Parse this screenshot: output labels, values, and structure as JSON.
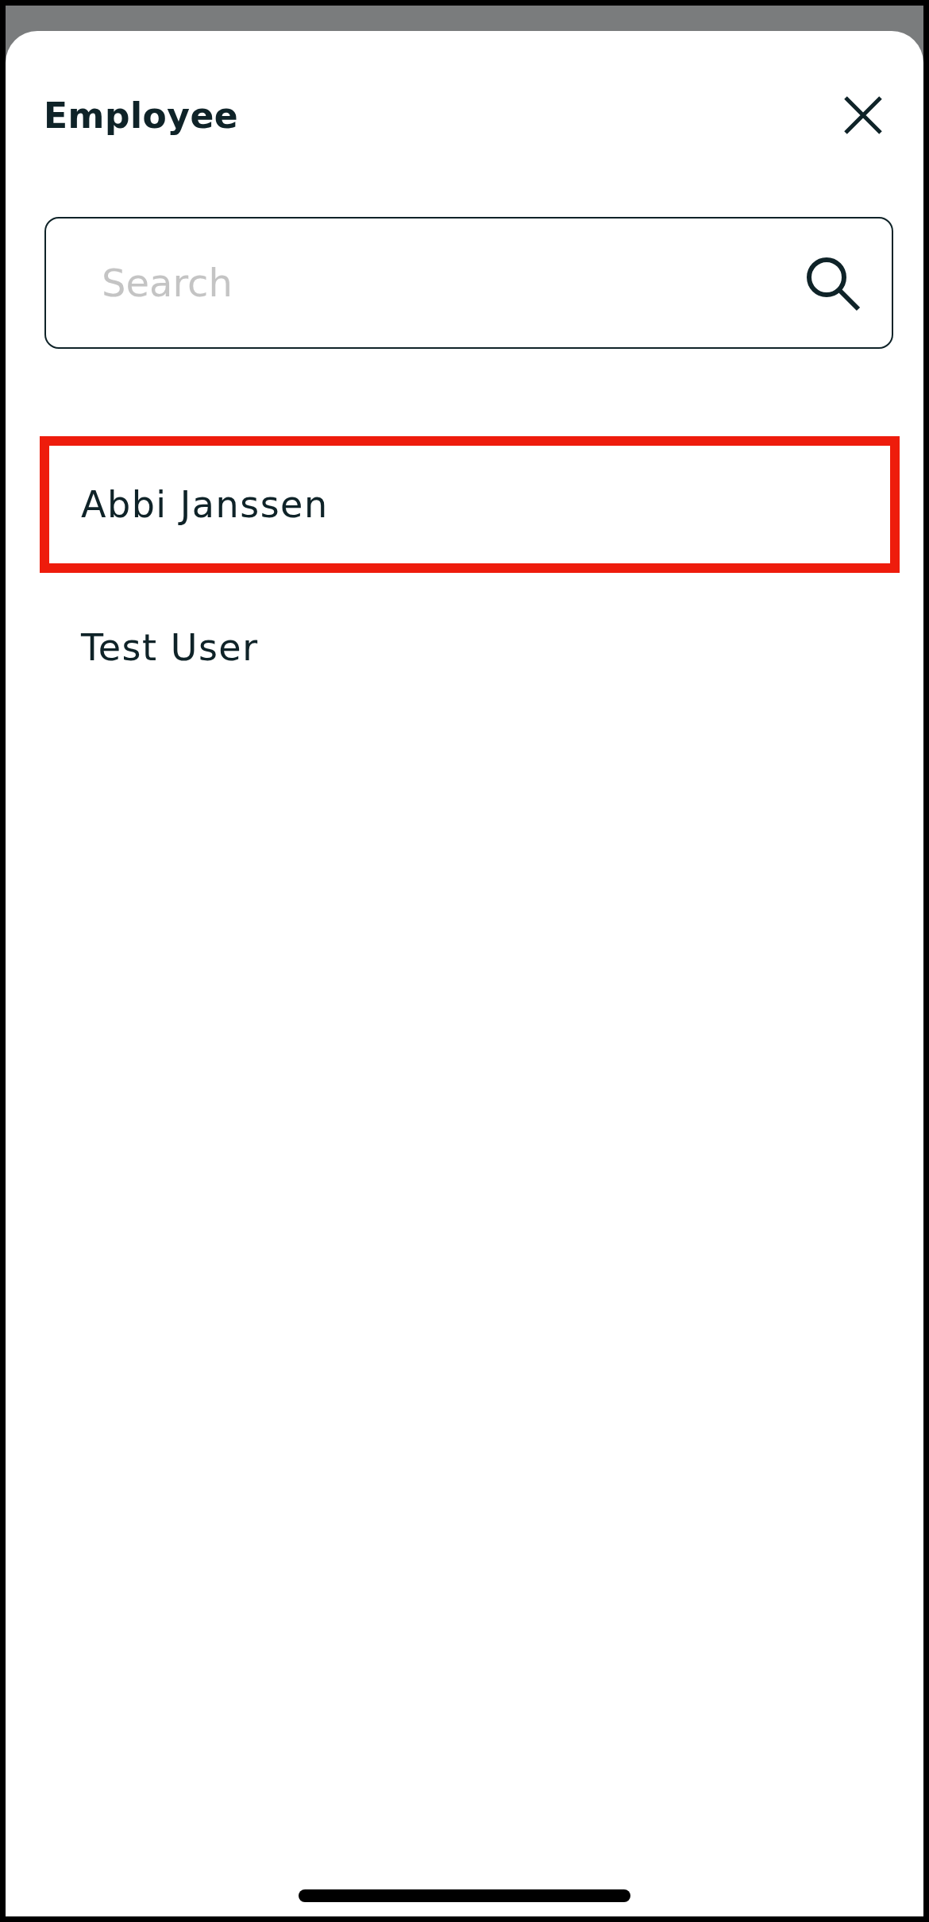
{
  "sheet": {
    "title": "Employee"
  },
  "search": {
    "placeholder": "Search"
  },
  "employees": [
    {
      "name": "Abbi Janssen",
      "selected": true
    },
    {
      "name": "Test User",
      "selected": false
    }
  ]
}
